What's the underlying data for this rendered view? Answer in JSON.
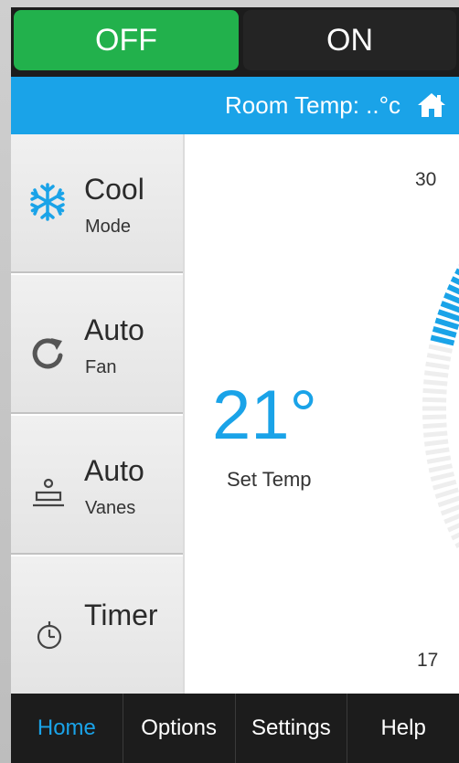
{
  "power": {
    "off_label": "OFF",
    "on_label": "ON",
    "state": "off",
    "active_color": "#22b14c"
  },
  "status": {
    "room_temp": "Room Temp:  ..°c",
    "icon": "home-icon",
    "bar_color": "#1aa3e8"
  },
  "sidebar": {
    "items": [
      {
        "title": "Cool",
        "subtitle": "Mode",
        "icon": "snowflake-icon"
      },
      {
        "title": "Auto",
        "subtitle": "Fan",
        "icon": "fan-rotate-icon"
      },
      {
        "title": "Auto",
        "subtitle": "Vanes",
        "icon": "vanes-icon"
      },
      {
        "title": "Timer",
        "subtitle": "",
        "icon": "timer-icon"
      }
    ]
  },
  "main": {
    "set_temp": "21°",
    "set_temp_label": "Set Temp",
    "dial_max": "30",
    "dial_min": "17",
    "setpoint_value": 21,
    "range": [
      17,
      30
    ],
    "accent_color": "#1aa3e8"
  },
  "nav": {
    "tabs": [
      {
        "label": "Home",
        "active": true
      },
      {
        "label": "Options",
        "active": false
      },
      {
        "label": "Settings",
        "active": false
      },
      {
        "label": "Help",
        "active": false
      }
    ]
  }
}
